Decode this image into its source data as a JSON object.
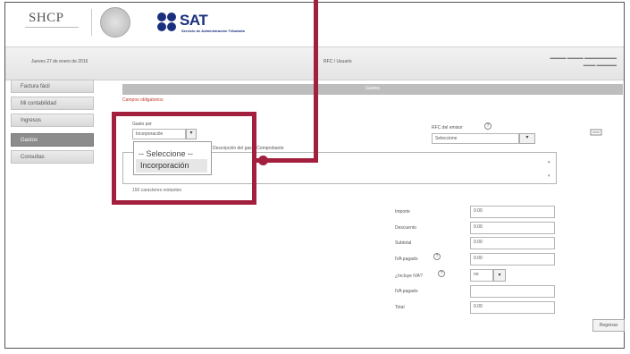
{
  "header": {
    "shcp_logo": "SHCP",
    "sat_logo": "SAT",
    "sat_subtitle": "Servicio de Administración Tributaria"
  },
  "topbar": {
    "date": "Jueves 27 de enero de 2016",
    "rfc": "RFC / Usuario"
  },
  "sidebar": {
    "items": [
      {
        "label": "Factura fácil",
        "active": false
      },
      {
        "label": "Mi contabilidad",
        "active": false
      },
      {
        "label": "Ingresos",
        "active": false
      },
      {
        "label": "Gastos",
        "active": true
      },
      {
        "label": "Consultas",
        "active": false
      }
    ]
  },
  "main": {
    "section_title": "Gastos",
    "required_note": "Campos obligatorios",
    "gasto_por": {
      "label": "Gasto por",
      "value": "Incorporación"
    },
    "description_label": "Descripción del gasto/Comprobante",
    "rfc_emisor": {
      "label": "RFC del emisor",
      "value": "Seleccione"
    },
    "chars_remaining": "150 caracteres restantes",
    "dropdown_options": [
      "-- Seleccione --",
      "Incorporación"
    ],
    "amounts": [
      {
        "label": "Importe",
        "value": "0.00"
      },
      {
        "label": "Descuento",
        "value": "0.00"
      },
      {
        "label": "Subtotal",
        "value": "0.00"
      },
      {
        "label": "IVA pagado",
        "value": "0.00"
      },
      {
        "label": "¿Incluye IVA?",
        "value": "no"
      },
      {
        "label": "IVA pagado",
        "value": ""
      },
      {
        "label": "Total",
        "value": "0.00"
      }
    ],
    "regresar_label": "Regresar"
  },
  "colors": {
    "highlight": "#a31f3e",
    "sat_blue": "#1b2f7e",
    "required_red": "#c0392b"
  }
}
